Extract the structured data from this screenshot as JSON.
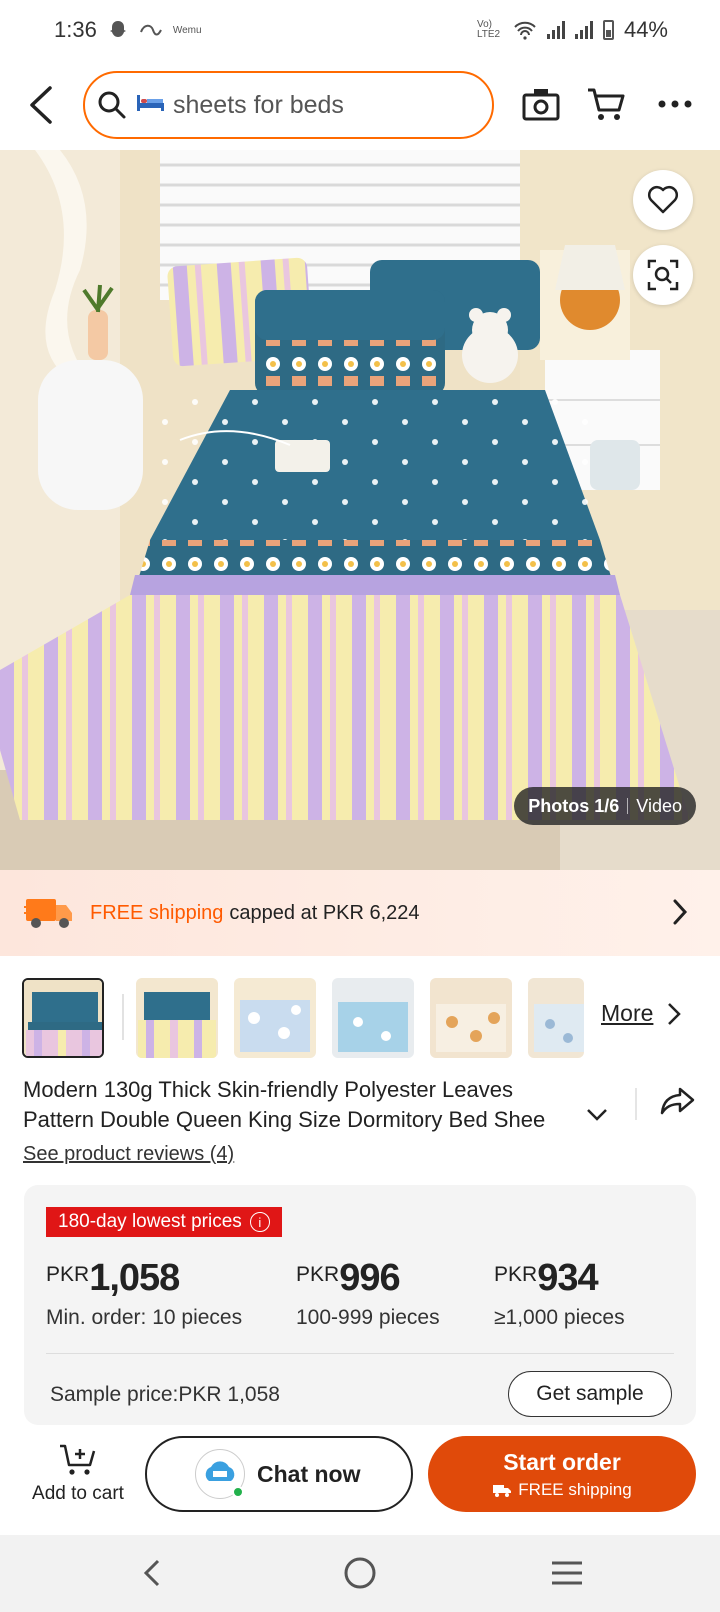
{
  "status_bar": {
    "time": "1:36",
    "mini_label": "Wemu",
    "network": "Vo) LTE2",
    "battery": "44%"
  },
  "header": {
    "search_placeholder": "sheets for beds",
    "icons": [
      "back-icon",
      "search-icon",
      "bed-icon",
      "camera-icon",
      "cart-icon",
      "more-icon"
    ]
  },
  "gallery": {
    "photos_counter": "Photos 1/6",
    "video_label": "Video",
    "thumbnail_count": 6,
    "more_label": "More"
  },
  "shipping": {
    "free_label": "FREE shipping",
    "rest_label": "capped at PKR 6,224"
  },
  "product": {
    "title_line1": "Modern 130g Thick Skin-friendly Polyester Leaves",
    "title_line2": "Pattern Double Queen King Size Dormitory Bed Shee",
    "reviews_link": "See product reviews (4)"
  },
  "pricing": {
    "badge": "180-day lowest prices",
    "tiers": [
      {
        "currency": "PKR",
        "amount": "1,058",
        "qty": "Min. order: 10 pieces"
      },
      {
        "currency": "PKR",
        "amount": "996",
        "qty": "100-999 pieces"
      },
      {
        "currency": "PKR",
        "amount": "934",
        "qty": "≥1,000 pieces"
      }
    ],
    "sample_price": "Sample price:PKR 1,058",
    "get_sample": "Get sample"
  },
  "actions": {
    "add_to_cart": "Add to cart",
    "chat_now": "Chat now",
    "start_order": "Start order",
    "start_order_sub": "FREE shipping"
  },
  "colors": {
    "accent_orange": "#ff6a00",
    "order_button": "#e04a0a",
    "badge_red": "#e01616"
  }
}
